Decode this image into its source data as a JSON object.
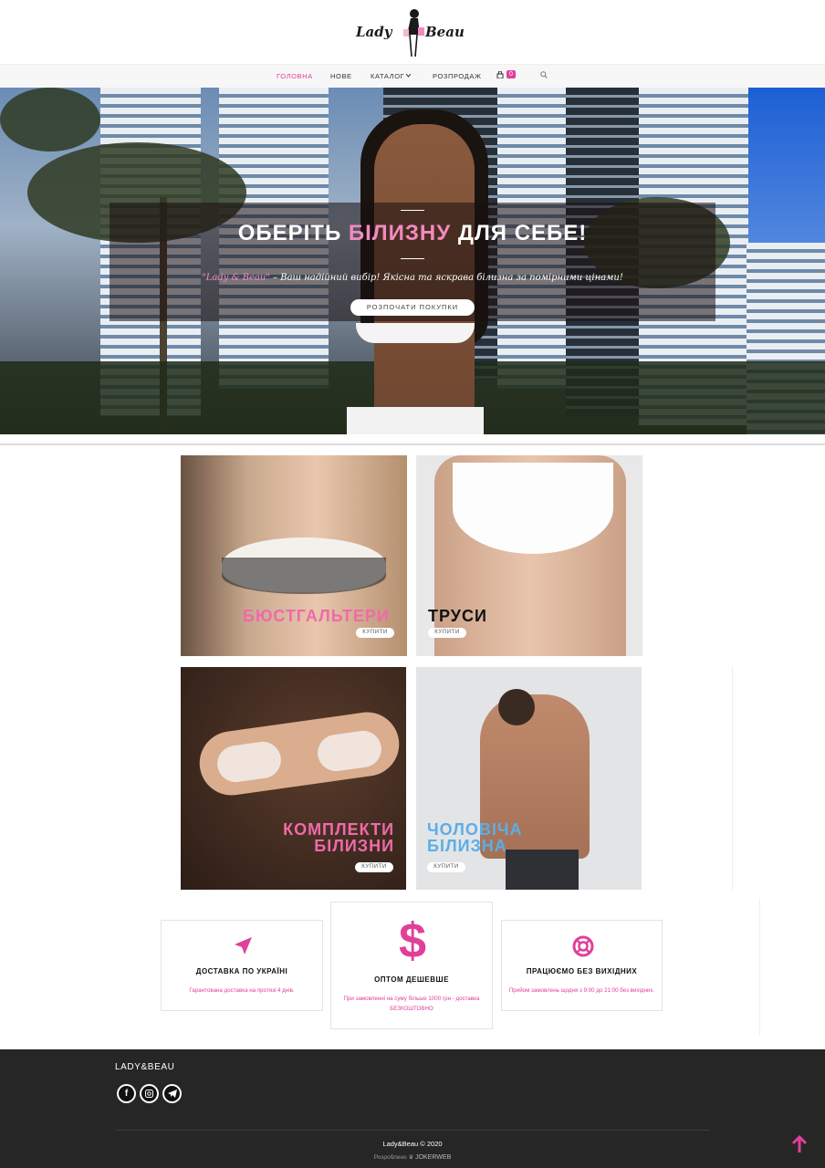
{
  "brand": {
    "logo_left": "Lady",
    "logo_right": "Beau"
  },
  "nav": {
    "items": [
      "ГОЛОВНА",
      "НОВЕ",
      "КАТАЛОГ",
      "РОЗПРОДАЖ"
    ],
    "cart_count": "0"
  },
  "hero": {
    "title_part1": "ОБЕРІТЬ ",
    "title_highlight": "БІЛИЗНУ",
    "title_part2": " ДЛЯ СЕБЕ!",
    "subtitle_brand": "\"Lady & Beau\"",
    "subtitle_rest": " – Ваш надійний вибір! Якісна та яскрава білизна за помірними цінами!",
    "button": "РОЗПОЧАТИ ПОКУПКИ"
  },
  "categories": [
    {
      "label": "БЮСТГАЛЬТЕРИ",
      "button": "КУПИТИ",
      "color": "#f06aa9"
    },
    {
      "label": "ТРУСИ",
      "button": "КУПИТИ",
      "color": "#111111"
    },
    {
      "label_line1": "КОМПЛЕКТИ",
      "label_line2": "БІЛИЗНИ",
      "button": "КУПИТИ",
      "color": "#f06aa9"
    },
    {
      "label_line1": "ЧОЛОВІЧА",
      "label_line2": "БІЛИЗНА",
      "button": "КУПИТИ",
      "color": "#5aaee8"
    }
  ],
  "features": [
    {
      "icon": "paper-plane-icon",
      "title": "ДОСТАВКА ПО УКРАЇНІ",
      "text": "Гарантована доставка на протязі 4 днів."
    },
    {
      "icon": "dollar-icon",
      "title": "ОПТОМ ДЕШЕВШЕ",
      "text": "При замовленні на суму більше 1000 грн - доставка БЕЗКОШТОВНО"
    },
    {
      "icon": "lifebuoy-icon",
      "title": "ПРАЦЮЄМО БЕЗ ВИХІДНИХ",
      "text": "Прийом замовлень щодня з 9:00 до 21:00 без вихідних."
    }
  ],
  "footer": {
    "brand": "LADY&BEAU",
    "copyright": "Lady&Beau © 2020",
    "dev_label": "Розроблено",
    "dev_name": "JOKERWEB"
  },
  "colors": {
    "accent": "#e0409a",
    "footer_bg": "#262626"
  }
}
